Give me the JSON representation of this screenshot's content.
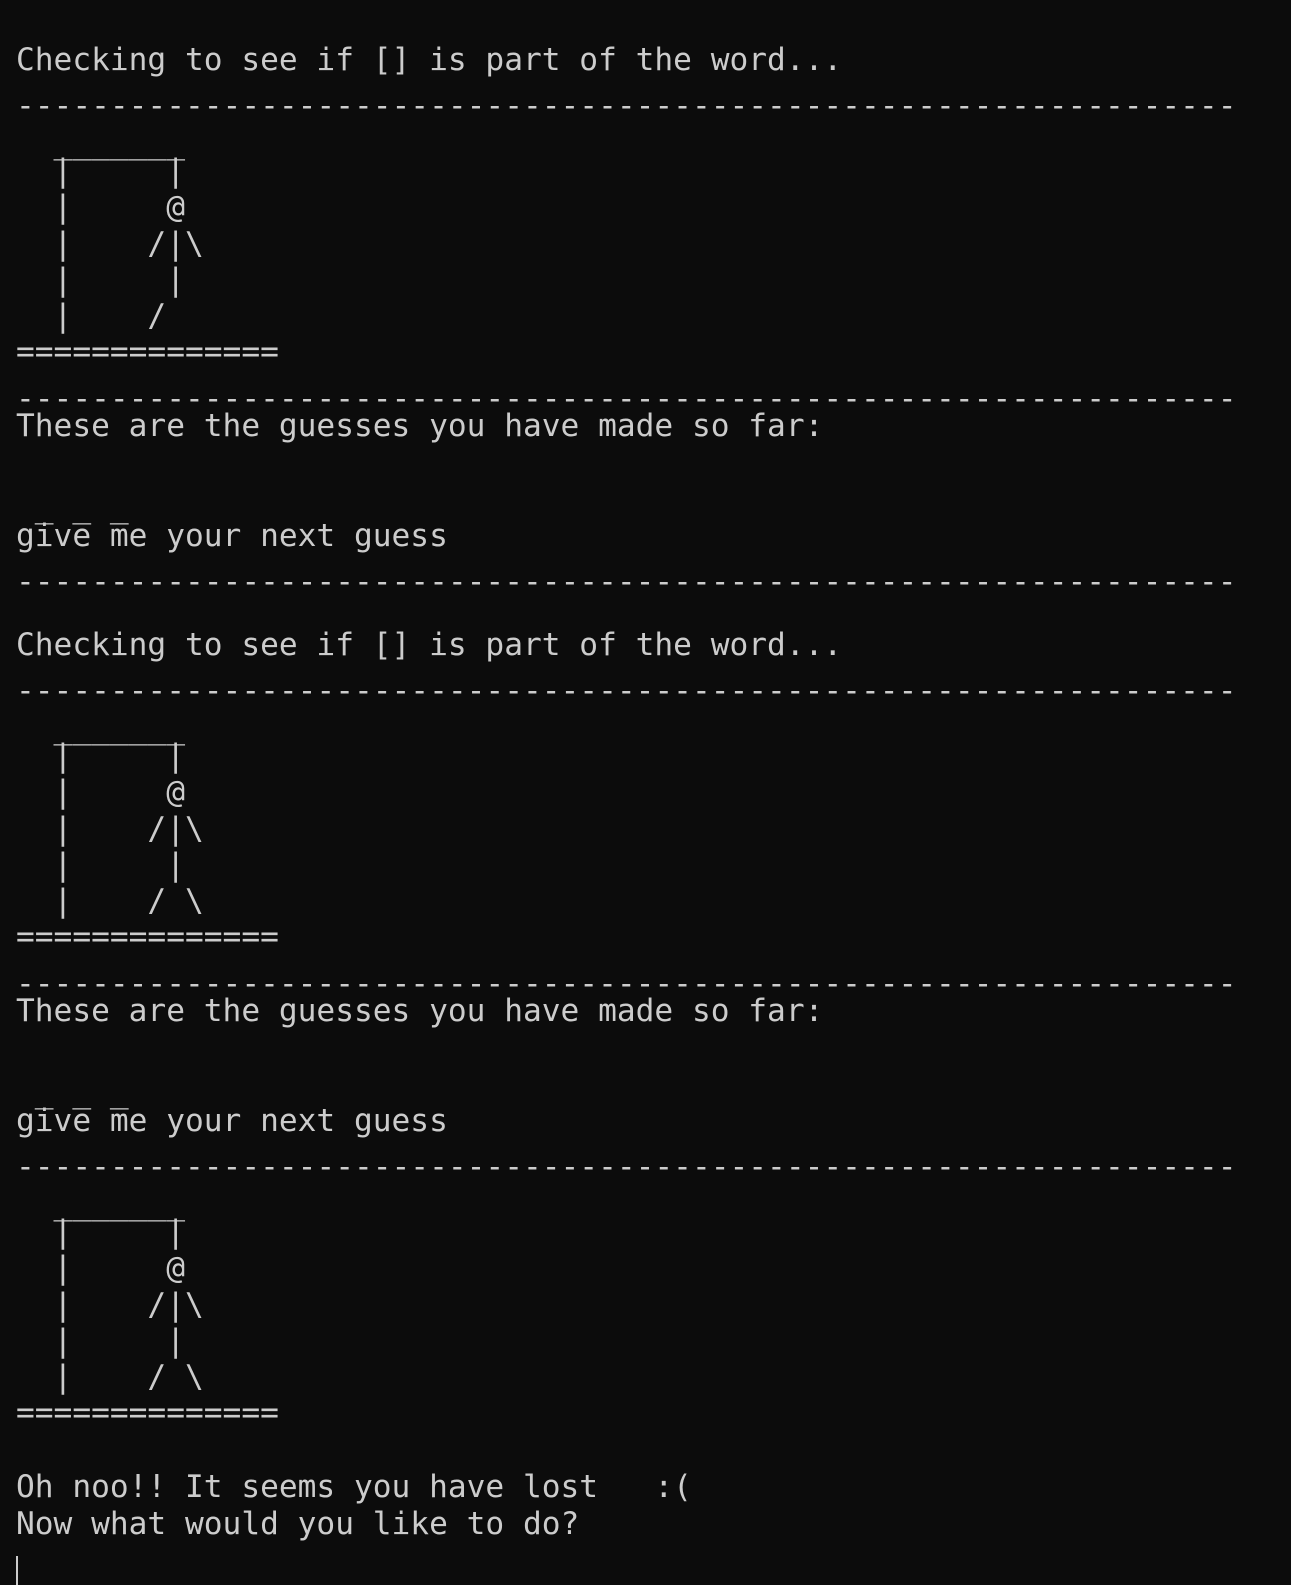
{
  "terminal": {
    "lines": [
      "Checking to see if [] is part of the word...",
      "-----------------------------------------------------------------",
      "  _______",
      "  |     |",
      "  |     @",
      "  |    /|\\",
      "  |     |",
      "  |    /",
      "==============",
      "-----------------------------------------------------------------",
      "These are the guesses you have made so far:",
      " _ _ _",
      "give me your next guess",
      "-----------------------------------------------------------------",
      "Checking to see if [] is part of the word...",
      "-----------------------------------------------------------------",
      "  _______",
      "  |     |",
      "  |     @",
      "  |    /|\\",
      "  |     |",
      "  |    / \\",
      "==============",
      "-----------------------------------------------------------------",
      "These are the guesses you have made so far:",
      " _ _ _",
      "give me your next guess",
      "-----------------------------------------------------------------",
      "  _______",
      "  |     |",
      "  |     @",
      "  |    /|\\",
      "  |     |",
      "  |    / \\",
      "==============",
      "Oh noo!! It seems you have lost   :(",
      "Now what would you like to do?"
    ]
  }
}
